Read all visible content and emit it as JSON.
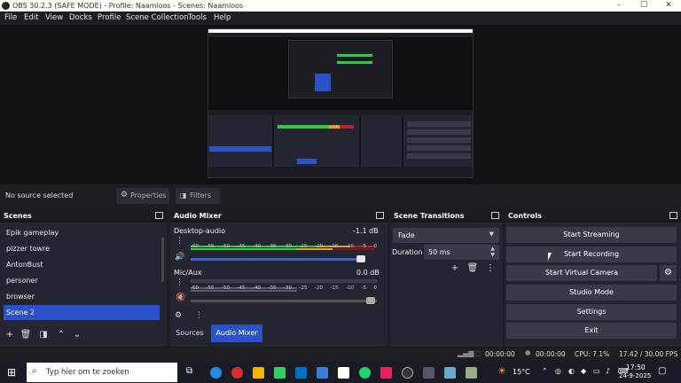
{
  "window": {
    "title": "OBS 30.2.3 (SAFE MODE) - Profile: Naamloos - Scenes: Naamloos"
  },
  "menu": [
    "File",
    "Edit",
    "View",
    "Docks",
    "Profile",
    "Scene Collection",
    "Tools",
    "Help"
  ],
  "source_bar": {
    "no_source": "No source selected",
    "properties": "Properties",
    "filters": "Filters"
  },
  "scenes": {
    "title": "Scenes",
    "items": [
      "Epik gameplay",
      "pizzer towre",
      "AntonBust",
      "personer",
      "browser",
      "Scene 2"
    ],
    "selected_index": 5
  },
  "mixer": {
    "title": "Audio Mixer",
    "channels": [
      {
        "name": "Desktop-audio",
        "db": "-1.1 dB",
        "volume": 0.95,
        "level": 0.93
      },
      {
        "name": "Mic/Aux",
        "db": "0.0 dB",
        "volume": 1.0,
        "level": 0.0
      }
    ],
    "scale": [
      "-60",
      "-55",
      "-50",
      "-45",
      "-40",
      "-35",
      "-30",
      "-25",
      "-20",
      "-15",
      "-10",
      "-5",
      "0"
    ],
    "tabs": [
      "Sources",
      "Audio Mixer"
    ]
  },
  "transitions": {
    "title": "Scene Transitions",
    "selected": "Fade",
    "duration_label": "Duration",
    "duration": "50 ms"
  },
  "controls": {
    "title": "Controls",
    "buttons": [
      "Start Streaming",
      "Start Recording",
      "Start Virtual Camera",
      "Studio Mode",
      "Settings",
      "Exit"
    ]
  },
  "status": {
    "stream_time": "00:00:00",
    "rec_time": "00:00:00",
    "cpu": "CPU: 7.1%",
    "fps": "17.42 / 30.00 FPS"
  },
  "taskbar": {
    "search_placeholder": "Typ hier om te zoeken",
    "weather": "15°C",
    "time": "17:50",
    "date": "24-9-2025"
  },
  "colors": {
    "selection": "#2b53c9",
    "panel": "#232630",
    "button": "#363b46"
  }
}
